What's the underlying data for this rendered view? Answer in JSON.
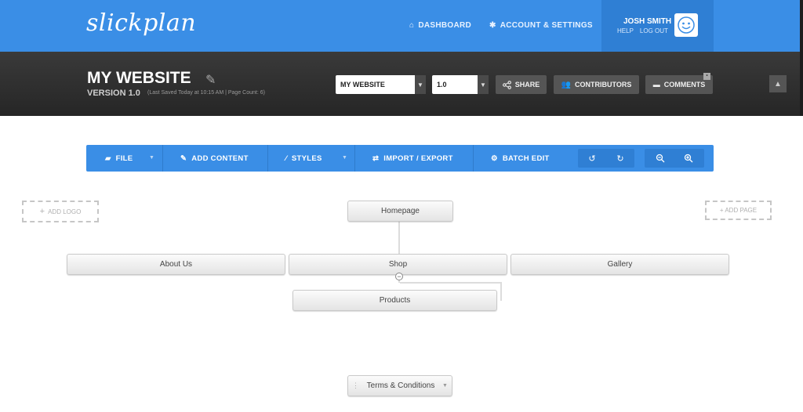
{
  "header": {
    "logo": "slickplan",
    "nav": [
      {
        "icon": "home-icon",
        "glyph": "⌂",
        "label": "DASHBOARD"
      },
      {
        "icon": "gear-icon",
        "glyph": "✱",
        "label": "ACCOUNT & SETTINGS"
      }
    ],
    "user": {
      "name": "JOSH SMITH",
      "help": "HELP",
      "logout": "LOG OUT"
    }
  },
  "project": {
    "title": "MY WEBSITE",
    "version": "VERSION 1.0",
    "meta": "(Last Saved Today at 10:15 AM  |  Page Count: 6)",
    "site_select": "MY WEBSITE",
    "version_select": "1.0",
    "share": "SHARE",
    "contributors": "CONTRIBUTORS",
    "comments": "COMMENTS"
  },
  "toolbar": {
    "file": "FILE",
    "add_content": "ADD CONTENT",
    "styles": "STYLES",
    "import_export": "IMPORT / EXPORT",
    "batch_edit": "BATCH EDIT"
  },
  "canvas": {
    "add_logo": "ADD LOGO",
    "add_page": "+ ADD PAGE",
    "pages": {
      "home": "Homepage",
      "about": "About Us",
      "shop": "Shop",
      "gallery": "Gallery",
      "products": "Products",
      "terms": "Terms & Conditions"
    }
  },
  "colors": {
    "brand_blue": "#3a8ee6",
    "dark_bar": "#2b2b2b"
  }
}
